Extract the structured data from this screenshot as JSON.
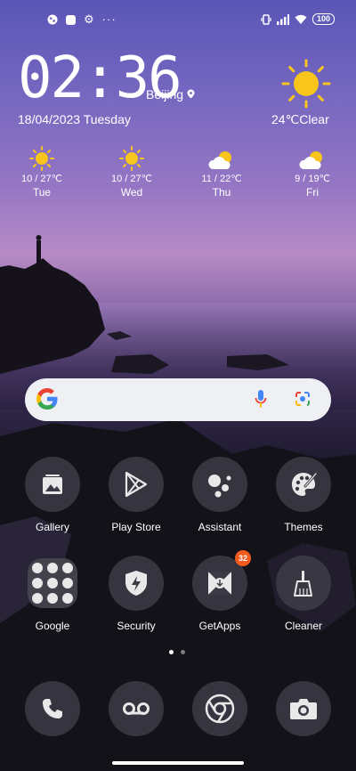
{
  "status_bar": {
    "left_icons": [
      "app-notification-icon",
      "square-notification-icon",
      "settings-notification-icon",
      "more-dots-icon"
    ],
    "right_icons": [
      "vibrate-icon",
      "signal-icon",
      "wifi-icon"
    ],
    "battery": "100"
  },
  "clock_widget": {
    "time": "02:36",
    "city": "Beijing",
    "date": "18/04/2023 Tuesday",
    "current_weather": "24℃Clear"
  },
  "forecast": [
    {
      "temp": "10 / 27℃",
      "day": "Tue",
      "icon": "sun-icon"
    },
    {
      "temp": "10 / 27℃",
      "day": "Wed",
      "icon": "sun-icon"
    },
    {
      "temp": "11 / 22℃",
      "day": "Thu",
      "icon": "partly-cloudy-icon"
    },
    {
      "temp": "9 / 19℃",
      "day": "Fri",
      "icon": "partly-cloudy-icon"
    }
  ],
  "search": {
    "logo": "G"
  },
  "apps_row1": [
    {
      "label": "Gallery",
      "icon": "gallery-icon"
    },
    {
      "label": "Play Store",
      "icon": "play-store-icon"
    },
    {
      "label": "Assistant",
      "icon": "assistant-icon"
    },
    {
      "label": "Themes",
      "icon": "palette-icon"
    }
  ],
  "apps_row2": [
    {
      "label": "Google",
      "icon": "folder-icon"
    },
    {
      "label": "Security",
      "icon": "shield-icon"
    },
    {
      "label": "GetApps",
      "icon": "getapps-icon",
      "badge": "32"
    },
    {
      "label": "Cleaner",
      "icon": "broom-icon"
    }
  ],
  "dock": [
    "phone-icon",
    "voicemail-icon",
    "chrome-icon",
    "camera-icon"
  ],
  "colors": {
    "badge": "#f25a1e",
    "sun": "#f7c51b",
    "search_bg": "#eef0f4"
  }
}
